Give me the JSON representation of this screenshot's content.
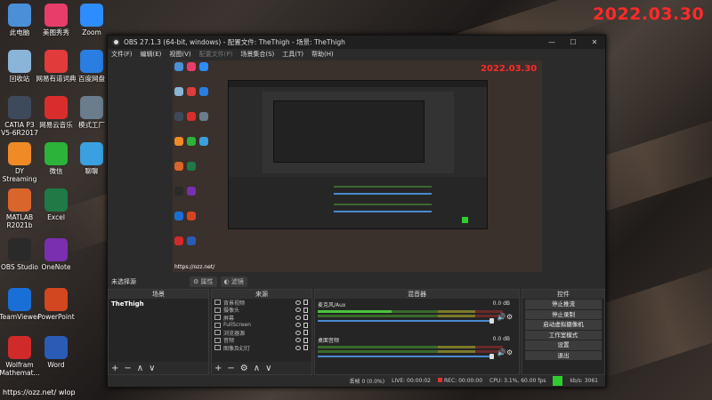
{
  "overlay_date": "2022.03.30",
  "desktop_icons": [
    {
      "name": "computer-icon",
      "label": "此电脑",
      "color": "#4a90d9"
    },
    {
      "name": "meitu-icon",
      "label": "美图秀秀",
      "color": "#e83d6a"
    },
    {
      "name": "zoom-icon",
      "label": "Zoom",
      "color": "#2d8cff"
    },
    {
      "name": "recycle-bin-icon",
      "label": "回收站",
      "color": "#8ab4d8"
    },
    {
      "name": "youdao-icon",
      "label": "网易有道词典",
      "color": "#e23b3b"
    },
    {
      "name": "baidu-netdisk-icon",
      "label": "百度网盘",
      "color": "#2a7de1"
    },
    {
      "name": "catia-icon",
      "label": "CATIA P3\nV5-6R2017",
      "color": "#3d4a5c"
    },
    {
      "name": "netease-music-icon",
      "label": "网易云音乐",
      "color": "#d92d2d"
    },
    {
      "name": "template-factory-icon",
      "label": "模式工厂",
      "color": "#6b7c8c"
    },
    {
      "name": "dy-streaming-icon",
      "label": "DY\nStreaming",
      "color": "#f08a24"
    },
    {
      "name": "wechat-icon",
      "label": "微信",
      "color": "#2bb33a"
    },
    {
      "name": "feishu-icon",
      "label": "聊聊",
      "color": "#3aa0e0"
    },
    {
      "name": "matlab-icon",
      "label": "MATLAB\nR2021b",
      "color": "#d9652a"
    },
    {
      "name": "excel-icon",
      "label": "Excel",
      "color": "#1f7a45"
    },
    {
      "name": "obs-icon",
      "label": "OBS Studio",
      "color": "#2a2a2a"
    },
    {
      "name": "onenote-icon",
      "label": "OneNote",
      "color": "#7a2fb0"
    },
    {
      "name": "teamviewer-icon",
      "label": "TeamViewer",
      "color": "#1a6fd6"
    },
    {
      "name": "powerpoint-icon",
      "label": "PowerPoint",
      "color": "#d2471f"
    },
    {
      "name": "wolfram-icon",
      "label": "Wolfram\nMathemat...",
      "color": "#d12a2a"
    },
    {
      "name": "word-icon",
      "label": "Word",
      "color": "#2a5bb5"
    }
  ],
  "window": {
    "title": "OBS 27.1.3 (64-bit, windows) - 配置文件: TheThigh - 场景: TheThigh",
    "menu": [
      "文件(F)",
      "编辑(E)",
      "视图(V)",
      "配置文件(P)",
      "场景集合(S)",
      "工具(T)",
      "帮助(H)"
    ],
    "menu_disabled": [
      false,
      false,
      false,
      true,
      false,
      false,
      false
    ],
    "ctrl_min": "—",
    "ctrl_max": "☐",
    "ctrl_close": "✕"
  },
  "preview": {
    "date": "2022.03.30",
    "footer": "https://ozz.net/"
  },
  "source_bar": {
    "label": "未选择源",
    "properties": "属性",
    "filters": "滤镜"
  },
  "scenes": {
    "title": "场景",
    "items": [
      "TheThigh"
    ]
  },
  "sources": {
    "title": "来源",
    "items": [
      "背景视频",
      "摄像头",
      "屏幕",
      "FullScreen",
      "浏览器源",
      "音频",
      "图像及幻灯"
    ]
  },
  "mixer": {
    "title": "混音器",
    "channels": [
      {
        "name": "麦克风/Aux",
        "db": "0.0 dB"
      },
      {
        "name": "桌面音频",
        "db": "0.0 dB"
      }
    ]
  },
  "controls": {
    "title": "控件",
    "buttons": [
      "停止推流",
      "停止录制",
      "启动虚拟摄像机",
      "工作室模式",
      "设置",
      "退出"
    ]
  },
  "dock_foot": {
    "add": "+",
    "remove": "−",
    "up": "∧",
    "down": "∨",
    "gear": "⚙"
  },
  "status": {
    "dropped": "丢帧 0 (0.0%)",
    "live": "LIVE: 00:00:02",
    "rec": "REC: 00:00:00",
    "cpu": "CPU: 3.1%, 60.00 fps",
    "kbps": "kb/s: 3061"
  },
  "url": "https://ozz.net/ wlop"
}
